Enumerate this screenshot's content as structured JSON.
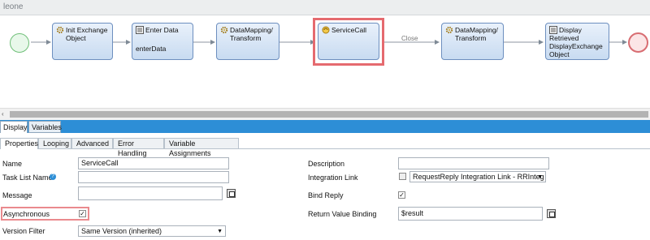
{
  "window": {
    "title": "leone"
  },
  "flow": {
    "nodes": [
      {
        "label": "Init Exchange Object",
        "lines": [
          "Init Exchange",
          "Object"
        ],
        "icon": "gear-icon"
      },
      {
        "label": "Enter Data",
        "lines": [
          "Enter Data"
        ],
        "sub": "enterData",
        "icon": "form-icon"
      },
      {
        "label": "DataMapping/ Transform",
        "lines": [
          "DataMapping/",
          "Transform"
        ],
        "icon": "gear-icon"
      },
      {
        "label": "ServiceCall",
        "lines": [
          "ServiceCall"
        ],
        "icon": "service-icon"
      },
      {
        "label": "DataMapping/ Transform",
        "lines": [
          "DataMapping/",
          "Transform"
        ],
        "icon": "gear-icon"
      },
      {
        "label": "Display Retrieved DisplayExchange Object",
        "lines": [
          "Display",
          "Retrieved",
          "DisplayExchange",
          "Object"
        ],
        "icon": "form-icon"
      }
    ],
    "edge_label": "Close"
  },
  "tabs": {
    "display": "Display",
    "variables": "Variables"
  },
  "subtabs": [
    "Properties",
    "Looping",
    "Advanced",
    "Error Handling",
    "Variable Assignments"
  ],
  "props": {
    "name_label": "Name",
    "name_value": "ServiceCall",
    "task_list_name_label": "Task List Name",
    "task_list_name_value": "",
    "message_label": "Message",
    "message_value": "",
    "asynchronous_label": "Asynchronous",
    "asynchronous_checked": true,
    "version_filter_label": "Version Filter",
    "version_filter_value": "Same Version (inherited)",
    "description_label": "Description",
    "description_value": "",
    "integration_link_label": "Integration Link",
    "integration_link_value": "RequestReply Integration Link - RRInteg",
    "bind_reply_label": "Bind Reply",
    "bind_reply_checked": true,
    "return_value_binding_label": "Return Value Binding",
    "return_value_binding_value": "$result"
  },
  "colors": {
    "accent": "#2d8ed6",
    "highlight": "#e56a6f",
    "start": "#7fd38a",
    "end": "#e07c80",
    "node_border": "#6d8fbf"
  }
}
